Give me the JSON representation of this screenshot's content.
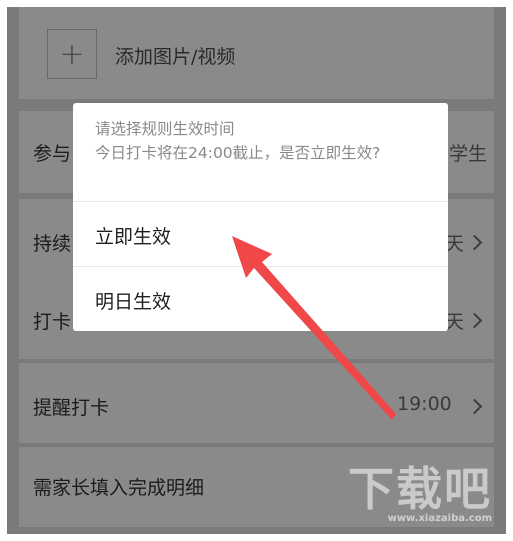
{
  "background_rows": {
    "add_media_label": "添加图片/视频",
    "participants_label": "参与",
    "participants_value": "学生",
    "duration_label": "持续",
    "duration_value": "天",
    "checkin_label": "打卡",
    "checkin_value": "天",
    "reminder_label": "提醒打卡",
    "reminder_time": "19:00",
    "parent_detail_label": "需家长填入完成明细"
  },
  "dialog": {
    "title": "请选择规则生效时间",
    "message": "今日打卡将在24:00截止，是否立即生效?",
    "option_immediate": "立即生效",
    "option_tomorrow": "明日生效"
  },
  "watermark": {
    "logo_text": "下载吧",
    "url_text": "www.xiazaiba.com"
  },
  "colors": {
    "overlay_background": "#7a7a7a",
    "dialog_background": "#ffffff",
    "annotation_arrow": "#f04848"
  }
}
